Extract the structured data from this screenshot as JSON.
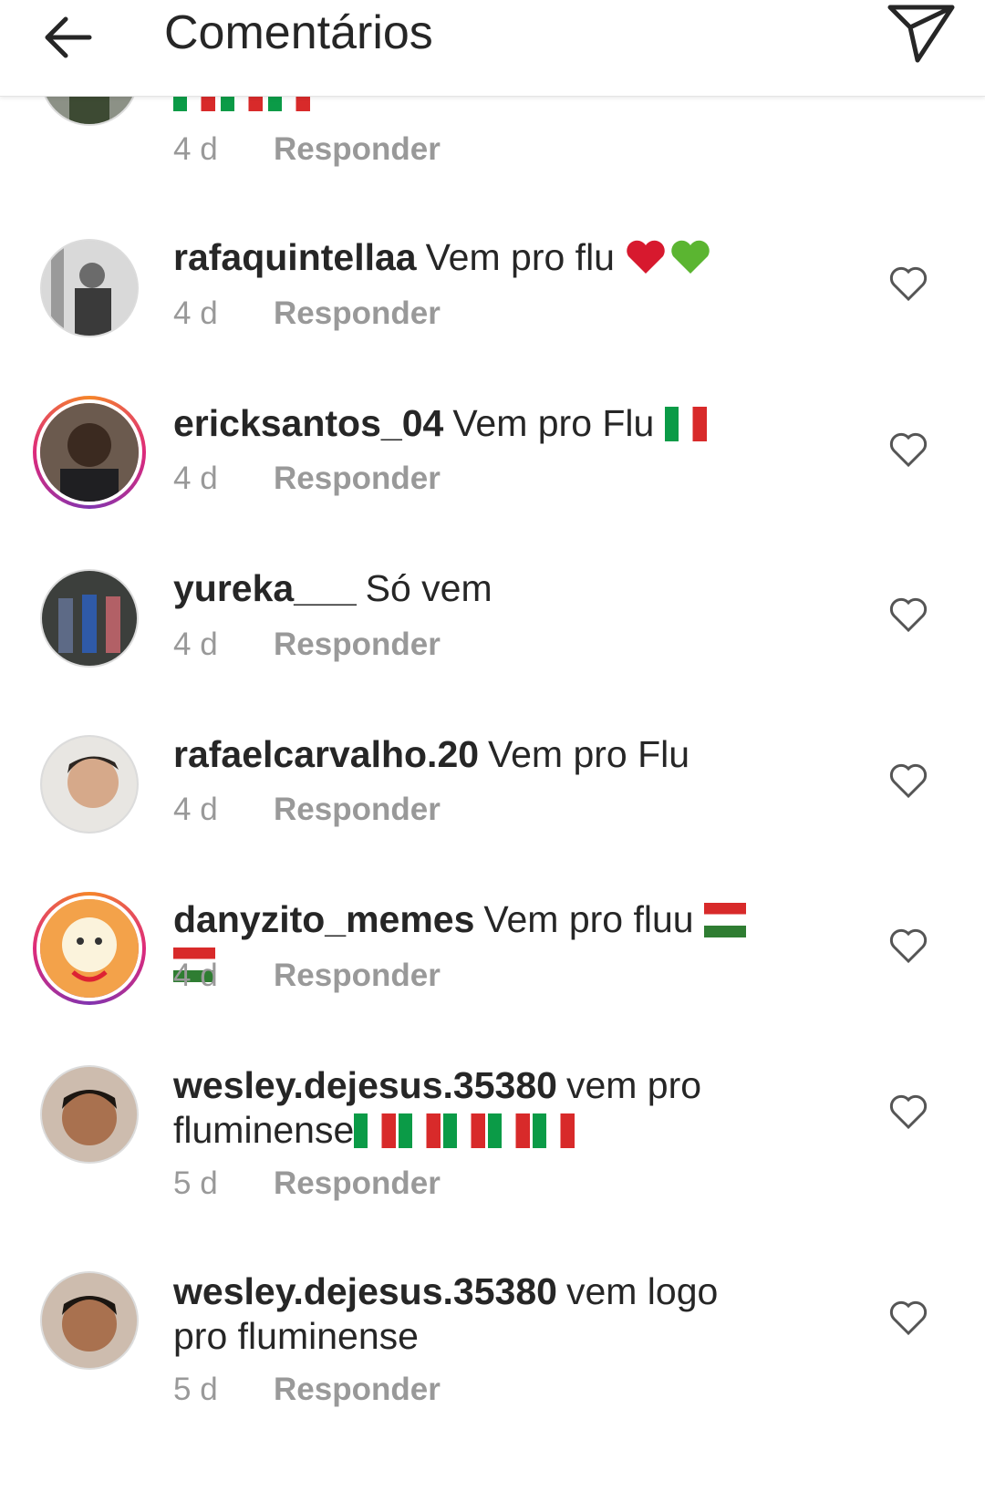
{
  "header": {
    "title": "Comentários",
    "back_icon": "arrow-left-icon",
    "send_icon": "paper-plane-icon"
  },
  "reply_label": "Responder",
  "colors": {
    "text": "#262626",
    "meta": "#999999",
    "like_outline": "#262626"
  },
  "partial_comment": {
    "age": "4 d",
    "emoji": "italy-flag x3 (cropped)"
  },
  "comments": [
    {
      "username": "rafaquintellaa",
      "text": "Vem pro flu",
      "emoji": "red-heart + green-heart",
      "age": "4 d"
    },
    {
      "username": "ericksantos_04",
      "text": "Vem pro Flu",
      "emoji": "italy-flag",
      "age": "4 d"
    },
    {
      "username": "yureka___",
      "text": "Só vem",
      "age": "4 d"
    },
    {
      "username": "rafaelcarvalho.20",
      "text": "Vem pro Flu",
      "age": "4 d"
    },
    {
      "username": "danyzito_memes",
      "text": "Vem pro fluu",
      "emoji": "hungary-flag x2",
      "age": "4 d"
    },
    {
      "username": "wesley.dejesus.35380",
      "text": "vem pro fluminense",
      "emoji": "italy-flag x5",
      "age": "5 d"
    },
    {
      "username": "wesley.dejesus.35380",
      "text": "vem logo pro fluminense",
      "age": "5 d"
    }
  ]
}
